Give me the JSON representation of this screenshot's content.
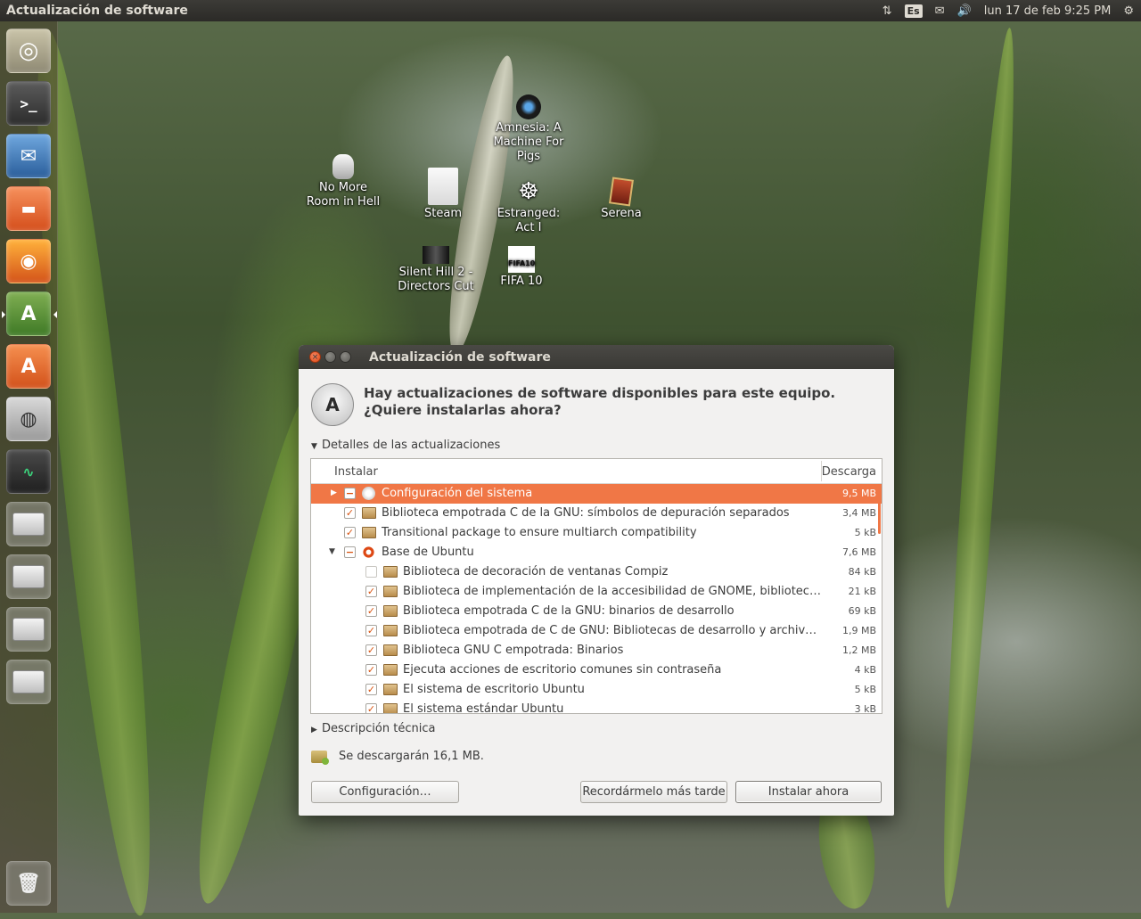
{
  "top_panel": {
    "app_title": "Actualización de software",
    "keyboard_layout": "Es",
    "clock": "lun 17 de feb  9:25 PM",
    "icons": [
      "network-arrows-icon",
      "mail-icon",
      "volume-icon",
      "gear-icon"
    ]
  },
  "launcher": {
    "items": [
      "ubuntu-dash-icon",
      "terminal-icon",
      "thunderbird-icon",
      "files-icon",
      "firefox-icon",
      "software-updater-icon",
      "software-center-icon",
      "camera-icon",
      "system-monitor-icon",
      "drive-icon",
      "drive-icon",
      "drive-icon",
      "drive-icon"
    ],
    "trash": "trash-icon"
  },
  "desktop": {
    "icons": [
      {
        "label": "Amnesia: A Machine For Pigs"
      },
      {
        "label": "No More Room in Hell"
      },
      {
        "label": "Steam"
      },
      {
        "label": "Estranged: Act I"
      },
      {
        "label": "Serena"
      },
      {
        "label": "Silent Hill 2 - Directors Cut"
      },
      {
        "label": "FIFA 10"
      }
    ],
    "fifa_badge": "FIFA10"
  },
  "dialog": {
    "title": "Actualización de software",
    "header_text": "Hay actualizaciones de software disponibles para este equipo. ¿Quiere instalarlas ahora?",
    "details_expander": "Detalles de las actualizaciones",
    "table": {
      "col_install": "Instalar",
      "col_download": "Descarga",
      "rows": [
        {
          "name": "Configuración del sistema",
          "size": "9,5 MB"
        },
        {
          "name": "Biblioteca empotrada C de la GNU: símbolos de depuración separados",
          "size": "3,4 MB"
        },
        {
          "name": "Transitional package to ensure multiarch compatibility",
          "size": "5 kB"
        },
        {
          "name": "Base de Ubuntu",
          "size": "7,6 MB"
        },
        {
          "name": "Biblioteca de decoración de ventanas Compiz",
          "size": "84 kB"
        },
        {
          "name": "Biblioteca de implementación de la accesibilidad de GNOME, bibliotecas co…",
          "size": "21 kB"
        },
        {
          "name": "Biblioteca empotrada C de la GNU: binarios de desarrollo",
          "size": "69 kB"
        },
        {
          "name": "Biblioteca empotrada de C de GNU: Bibliotecas de desarrollo y archivos de c…",
          "size": "1,9 MB"
        },
        {
          "name": "Biblioteca GNU C empotrada: Binarios",
          "size": "1,2 MB"
        },
        {
          "name": "Ejecuta acciones de escritorio comunes sin contraseña",
          "size": "4 kB"
        },
        {
          "name": "El sistema de escritorio Ubuntu",
          "size": "5 kB"
        },
        {
          "name": "El sistema estándar Ubuntu",
          "size": "3 kB"
        }
      ]
    },
    "tech_expander": "Descripción técnica",
    "download_text": "Se descargarán 16,1 MB.",
    "buttons": {
      "config": "Configuración…",
      "later": "Recordármelo más tarde",
      "install": "Instalar ahora"
    },
    "accent_color": "#f07746"
  }
}
